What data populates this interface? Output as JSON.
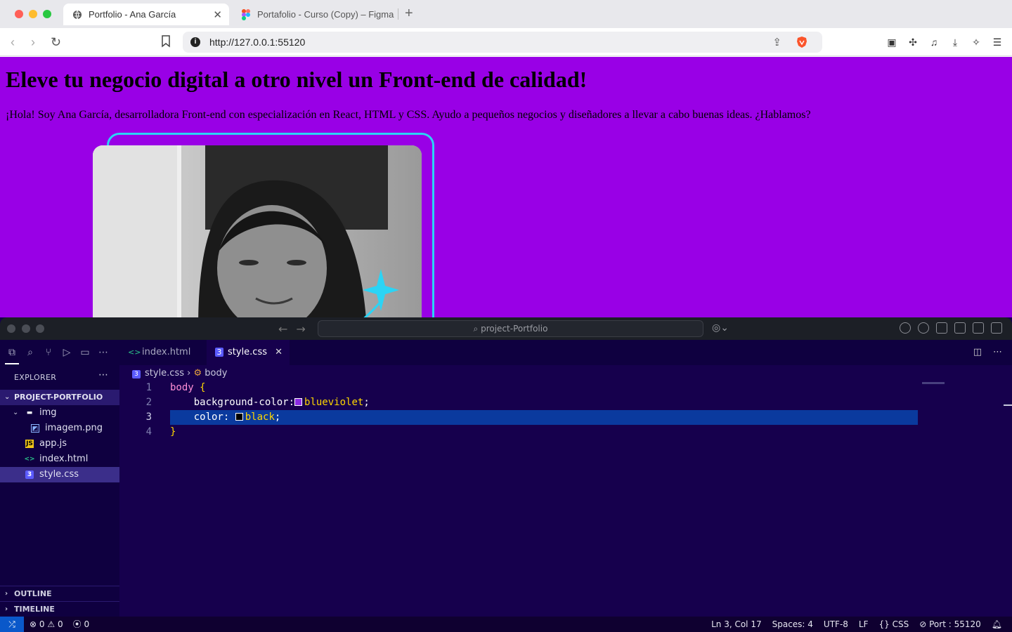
{
  "browser": {
    "tabs": [
      {
        "label": "Portfolio - Ana García",
        "active": true
      },
      {
        "label": "Portafolio - Curso (Copy) – Figma",
        "active": false
      }
    ],
    "url": "http://127.0.0.1:55120"
  },
  "site": {
    "title": "Eleve tu negocio digital a otro nivel un Front-end de calidad!",
    "intro": "¡Hola! Soy Ana García, desarrolladora Front-end con especialización en React, HTML y CSS. Ayudo a pequeños negocios y diseñadores a llevar a cabo buenas ideas. ¿Hablamos?",
    "background_color": "#9900e6",
    "frame_color": "#2bd4f5"
  },
  "vscode": {
    "search_placeholder": "project-Portfolio",
    "explorer_title": "EXPLORER",
    "project_name": "PROJECT-PORTFOLIO",
    "tree": [
      {
        "label": "img",
        "type": "folder"
      },
      {
        "label": "imagem.png",
        "type": "image"
      },
      {
        "label": "app.js",
        "type": "js"
      },
      {
        "label": "index.html",
        "type": "html"
      },
      {
        "label": "style.css",
        "type": "css",
        "selected": true
      }
    ],
    "outline_label": "OUTLINE",
    "timeline_label": "TIMELINE",
    "editor_tabs": [
      {
        "label": "index.html",
        "active": false
      },
      {
        "label": "style.css",
        "active": true
      }
    ],
    "breadcrumb": {
      "file": "style.css",
      "symbol": "body"
    },
    "code_lines": [
      {
        "n": "1",
        "selector": "body",
        "brace": "{"
      },
      {
        "n": "2",
        "property": "background-color:",
        "value": "blueviolet",
        "semicolon": ";",
        "swatch": "#8a2be2"
      },
      {
        "n": "3",
        "property": "color: ",
        "value": "black",
        "semicolon": ";",
        "swatch": "#000000"
      },
      {
        "n": "4",
        "brace": "}"
      }
    ],
    "status": {
      "errors": "0",
      "warnings": "0",
      "ports": "0",
      "position": "Ln 3, Col 17",
      "spaces": "Spaces: 4",
      "encoding": "UTF-8",
      "eol": "LF",
      "language": "CSS",
      "port": "Port : 55120"
    }
  }
}
